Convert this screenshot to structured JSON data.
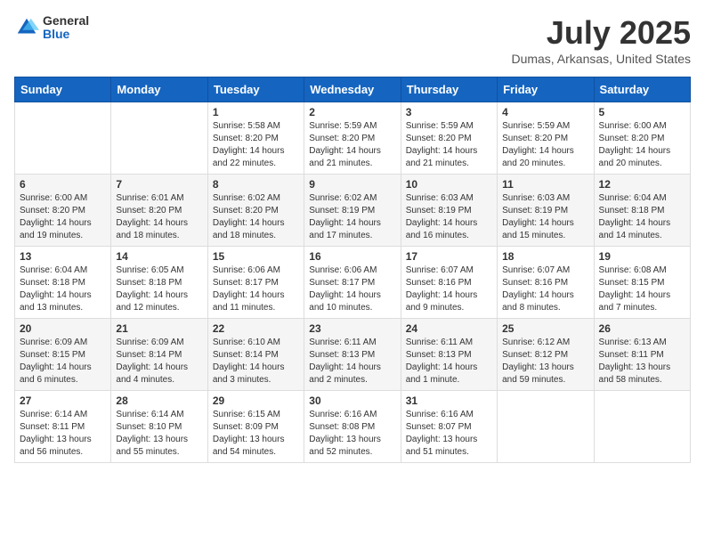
{
  "header": {
    "logo_general": "General",
    "logo_blue": "Blue",
    "title": "July 2025",
    "subtitle": "Dumas, Arkansas, United States"
  },
  "weekdays": [
    "Sunday",
    "Monday",
    "Tuesday",
    "Wednesday",
    "Thursday",
    "Friday",
    "Saturday"
  ],
  "weeks": [
    [
      {
        "day": "",
        "sunrise": "",
        "sunset": "",
        "daylight": ""
      },
      {
        "day": "",
        "sunrise": "",
        "sunset": "",
        "daylight": ""
      },
      {
        "day": "1",
        "sunrise": "Sunrise: 5:58 AM",
        "sunset": "Sunset: 8:20 PM",
        "daylight": "Daylight: 14 hours and 22 minutes."
      },
      {
        "day": "2",
        "sunrise": "Sunrise: 5:59 AM",
        "sunset": "Sunset: 8:20 PM",
        "daylight": "Daylight: 14 hours and 21 minutes."
      },
      {
        "day": "3",
        "sunrise": "Sunrise: 5:59 AM",
        "sunset": "Sunset: 8:20 PM",
        "daylight": "Daylight: 14 hours and 21 minutes."
      },
      {
        "day": "4",
        "sunrise": "Sunrise: 5:59 AM",
        "sunset": "Sunset: 8:20 PM",
        "daylight": "Daylight: 14 hours and 20 minutes."
      },
      {
        "day": "5",
        "sunrise": "Sunrise: 6:00 AM",
        "sunset": "Sunset: 8:20 PM",
        "daylight": "Daylight: 14 hours and 20 minutes."
      }
    ],
    [
      {
        "day": "6",
        "sunrise": "Sunrise: 6:00 AM",
        "sunset": "Sunset: 8:20 PM",
        "daylight": "Daylight: 14 hours and 19 minutes."
      },
      {
        "day": "7",
        "sunrise": "Sunrise: 6:01 AM",
        "sunset": "Sunset: 8:20 PM",
        "daylight": "Daylight: 14 hours and 18 minutes."
      },
      {
        "day": "8",
        "sunrise": "Sunrise: 6:02 AM",
        "sunset": "Sunset: 8:20 PM",
        "daylight": "Daylight: 14 hours and 18 minutes."
      },
      {
        "day": "9",
        "sunrise": "Sunrise: 6:02 AM",
        "sunset": "Sunset: 8:19 PM",
        "daylight": "Daylight: 14 hours and 17 minutes."
      },
      {
        "day": "10",
        "sunrise": "Sunrise: 6:03 AM",
        "sunset": "Sunset: 8:19 PM",
        "daylight": "Daylight: 14 hours and 16 minutes."
      },
      {
        "day": "11",
        "sunrise": "Sunrise: 6:03 AM",
        "sunset": "Sunset: 8:19 PM",
        "daylight": "Daylight: 14 hours and 15 minutes."
      },
      {
        "day": "12",
        "sunrise": "Sunrise: 6:04 AM",
        "sunset": "Sunset: 8:18 PM",
        "daylight": "Daylight: 14 hours and 14 minutes."
      }
    ],
    [
      {
        "day": "13",
        "sunrise": "Sunrise: 6:04 AM",
        "sunset": "Sunset: 8:18 PM",
        "daylight": "Daylight: 14 hours and 13 minutes."
      },
      {
        "day": "14",
        "sunrise": "Sunrise: 6:05 AM",
        "sunset": "Sunset: 8:18 PM",
        "daylight": "Daylight: 14 hours and 12 minutes."
      },
      {
        "day": "15",
        "sunrise": "Sunrise: 6:06 AM",
        "sunset": "Sunset: 8:17 PM",
        "daylight": "Daylight: 14 hours and 11 minutes."
      },
      {
        "day": "16",
        "sunrise": "Sunrise: 6:06 AM",
        "sunset": "Sunset: 8:17 PM",
        "daylight": "Daylight: 14 hours and 10 minutes."
      },
      {
        "day": "17",
        "sunrise": "Sunrise: 6:07 AM",
        "sunset": "Sunset: 8:16 PM",
        "daylight": "Daylight: 14 hours and 9 minutes."
      },
      {
        "day": "18",
        "sunrise": "Sunrise: 6:07 AM",
        "sunset": "Sunset: 8:16 PM",
        "daylight": "Daylight: 14 hours and 8 minutes."
      },
      {
        "day": "19",
        "sunrise": "Sunrise: 6:08 AM",
        "sunset": "Sunset: 8:15 PM",
        "daylight": "Daylight: 14 hours and 7 minutes."
      }
    ],
    [
      {
        "day": "20",
        "sunrise": "Sunrise: 6:09 AM",
        "sunset": "Sunset: 8:15 PM",
        "daylight": "Daylight: 14 hours and 6 minutes."
      },
      {
        "day": "21",
        "sunrise": "Sunrise: 6:09 AM",
        "sunset": "Sunset: 8:14 PM",
        "daylight": "Daylight: 14 hours and 4 minutes."
      },
      {
        "day": "22",
        "sunrise": "Sunrise: 6:10 AM",
        "sunset": "Sunset: 8:14 PM",
        "daylight": "Daylight: 14 hours and 3 minutes."
      },
      {
        "day": "23",
        "sunrise": "Sunrise: 6:11 AM",
        "sunset": "Sunset: 8:13 PM",
        "daylight": "Daylight: 14 hours and 2 minutes."
      },
      {
        "day": "24",
        "sunrise": "Sunrise: 6:11 AM",
        "sunset": "Sunset: 8:13 PM",
        "daylight": "Daylight: 14 hours and 1 minute."
      },
      {
        "day": "25",
        "sunrise": "Sunrise: 6:12 AM",
        "sunset": "Sunset: 8:12 PM",
        "daylight": "Daylight: 13 hours and 59 minutes."
      },
      {
        "day": "26",
        "sunrise": "Sunrise: 6:13 AM",
        "sunset": "Sunset: 8:11 PM",
        "daylight": "Daylight: 13 hours and 58 minutes."
      }
    ],
    [
      {
        "day": "27",
        "sunrise": "Sunrise: 6:14 AM",
        "sunset": "Sunset: 8:11 PM",
        "daylight": "Daylight: 13 hours and 56 minutes."
      },
      {
        "day": "28",
        "sunrise": "Sunrise: 6:14 AM",
        "sunset": "Sunset: 8:10 PM",
        "daylight": "Daylight: 13 hours and 55 minutes."
      },
      {
        "day": "29",
        "sunrise": "Sunrise: 6:15 AM",
        "sunset": "Sunset: 8:09 PM",
        "daylight": "Daylight: 13 hours and 54 minutes."
      },
      {
        "day": "30",
        "sunrise": "Sunrise: 6:16 AM",
        "sunset": "Sunset: 8:08 PM",
        "daylight": "Daylight: 13 hours and 52 minutes."
      },
      {
        "day": "31",
        "sunrise": "Sunrise: 6:16 AM",
        "sunset": "Sunset: 8:07 PM",
        "daylight": "Daylight: 13 hours and 51 minutes."
      },
      {
        "day": "",
        "sunrise": "",
        "sunset": "",
        "daylight": ""
      },
      {
        "day": "",
        "sunrise": "",
        "sunset": "",
        "daylight": ""
      }
    ]
  ]
}
